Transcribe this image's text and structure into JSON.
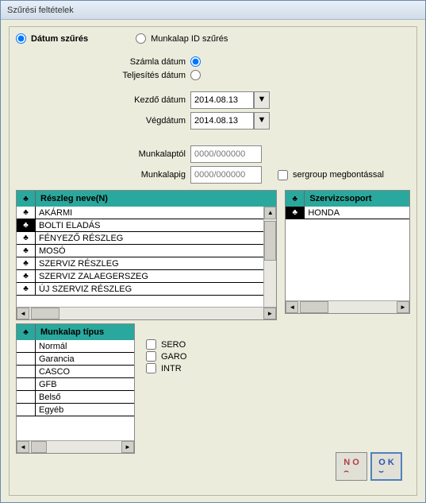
{
  "window": {
    "title": "Szűrési feltételek"
  },
  "radios": {
    "datum_szures": "Dátum szűrés",
    "munkalap_id_szures": "Munkalap ID szűrés",
    "szamla_datum": "Számla dátum",
    "teljesites_datum": "Teljesítés dátum"
  },
  "labels": {
    "kezdo_datum": "Kezdő dátum",
    "vegdatum": "Végdátum",
    "munkalaptol": "Munkalaptól",
    "munkalapig": "Munkalapig"
  },
  "dates": {
    "kezdo": "2014.08.13",
    "veg": "2014.08.13"
  },
  "placeholders": {
    "munkalaptol": "0000/000000",
    "munkalapig": "0000/000000"
  },
  "checkboxes": {
    "sergroup": "sergroup megbontással",
    "sero": "SERO",
    "garo": "GARO",
    "intr": "INTR"
  },
  "reszleg": {
    "header": "Részleg neve(N)",
    "items": [
      "AKÁRMI",
      "BOLTI ELADÁS",
      "FÉNYEZŐ RÉSZLEG",
      "MOSÓ",
      "SZERVIZ RÉSZLEG",
      "SZERVIZ ZALAEGERSZEG",
      "ÚJ SZERVIZ RÉSZLEG"
    ],
    "selected_index": 1
  },
  "szerviz": {
    "header": "Szervizcsoport",
    "items": [
      "HONDA"
    ],
    "selected_index": 0
  },
  "munkalap": {
    "header": "Munkalap típus",
    "items": [
      "Normál",
      "Garancia",
      "CASCO",
      "GFB",
      "Belső",
      "Egyéb"
    ]
  },
  "buttons": {
    "no": "N O",
    "ok": "O K"
  },
  "icons": {
    "club": "♣",
    "dropdown": "▼",
    "up": "▲",
    "down": "▼",
    "left": "◄",
    "right": "►"
  }
}
